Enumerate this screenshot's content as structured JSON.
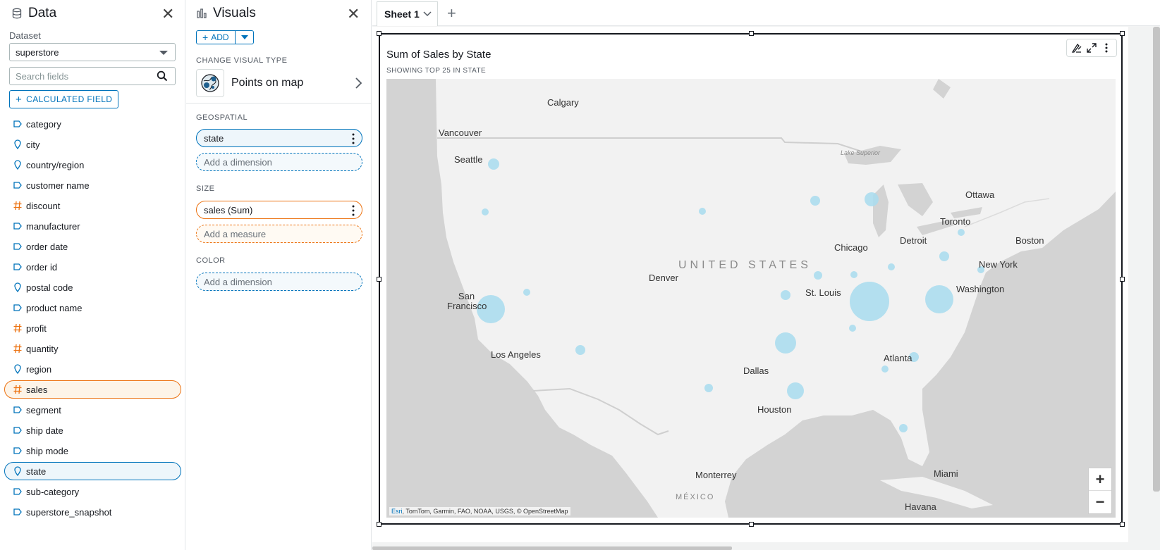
{
  "data_panel": {
    "title": "Data",
    "dataset_label": "Dataset",
    "dataset_value": "superstore",
    "search_placeholder": "Search fields",
    "calculated_field_label": "CALCULATED FIELD",
    "fields": [
      {
        "name": "category",
        "kind": "dimension"
      },
      {
        "name": "city",
        "kind": "geo"
      },
      {
        "name": "country/region",
        "kind": "geo"
      },
      {
        "name": "customer name",
        "kind": "dimension"
      },
      {
        "name": "discount",
        "kind": "measure"
      },
      {
        "name": "manufacturer",
        "kind": "dimension"
      },
      {
        "name": "order date",
        "kind": "dimension"
      },
      {
        "name": "order id",
        "kind": "dimension"
      },
      {
        "name": "postal code",
        "kind": "geo"
      },
      {
        "name": "product name",
        "kind": "dimension"
      },
      {
        "name": "profit",
        "kind": "measure"
      },
      {
        "name": "quantity",
        "kind": "measure"
      },
      {
        "name": "region",
        "kind": "geo"
      },
      {
        "name": "sales",
        "kind": "measure",
        "selected": "orange"
      },
      {
        "name": "segment",
        "kind": "dimension"
      },
      {
        "name": "ship date",
        "kind": "dimension"
      },
      {
        "name": "ship mode",
        "kind": "dimension"
      },
      {
        "name": "state",
        "kind": "geo",
        "selected": "blue"
      },
      {
        "name": "sub-category",
        "kind": "dimension"
      },
      {
        "name": "superstore_snapshot",
        "kind": "dimension"
      }
    ]
  },
  "visuals_panel": {
    "title": "Visuals",
    "add_label": "ADD",
    "change_type_label": "CHANGE VISUAL TYPE",
    "visual_type": "Points on map",
    "geospatial_label": "GEOSPATIAL",
    "geospatial_value": "state",
    "geospatial_add": "Add a dimension",
    "size_label": "SIZE",
    "size_value": "sales (Sum)",
    "size_add": "Add a measure",
    "color_label": "COLOR",
    "color_add": "Add a dimension"
  },
  "sheet_tab": {
    "label": "Sheet 1"
  },
  "visual": {
    "title": "Sum of Sales by State",
    "subtitle": "SHOWING TOP 25 IN STATE",
    "attribution_esri": "Esri",
    "attribution_rest": ", TomTom, Garmin, FAO, NOAA, USGS, © OpenStreetMap",
    "map_labels": {
      "calgary": "Calgary",
      "vancouver": "Vancouver",
      "seattle": "Seattle",
      "lake_superior": "Lake Superior",
      "ottawa": "Ottawa",
      "toronto": "Toronto",
      "boston": "Boston",
      "detroit": "Detroit",
      "chicago": "Chicago",
      "new_york": "New York",
      "united_states": "UNITED STATES",
      "denver": "Denver",
      "st_louis": "St. Louis",
      "washington": "Washington",
      "san_francisco": "San Francisco",
      "los_angeles": "Los Angeles",
      "atlanta": "Atlanta",
      "dallas": "Dallas",
      "houston": "Houston",
      "monterrey": "Monterrey",
      "miami": "Miami",
      "mexico": "MÉXICO",
      "havana": "Havana"
    },
    "bubble_color": "#a8dcee"
  },
  "colors": {
    "accent_blue": "#0073bb",
    "accent_orange": "#ec7211",
    "land": "#f2f2f2",
    "water": "#d3d3d3"
  }
}
